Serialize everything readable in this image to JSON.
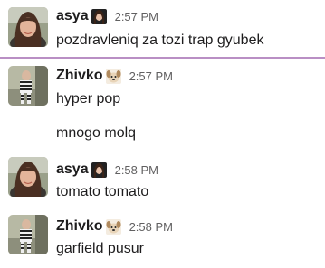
{
  "messages": [
    {
      "author": "asya",
      "author_badge_icon": "avatar-emoji-icon",
      "time": "2:57 PM",
      "lines": [
        "pozdravleniq za tozi trap gyubek"
      ]
    },
    {
      "author": "Zhivko",
      "author_badge_icon": "dog-emoji-icon",
      "time": "2:57 PM",
      "lines": [
        "hyper pop",
        "mnogo molq"
      ]
    },
    {
      "author": "asya",
      "author_badge_icon": "avatar-emoji-icon",
      "time": "2:58 PM",
      "lines": [
        "tomato tomato"
      ]
    },
    {
      "author": "Zhivko",
      "author_badge_icon": "dog-emoji-icon",
      "time": "2:58 PM",
      "lines": [
        "garfield pusur"
      ]
    }
  ],
  "colors": {
    "new_message_divider": "#b98fc4",
    "timestamp": "#616061",
    "text": "#1d1c1d"
  }
}
